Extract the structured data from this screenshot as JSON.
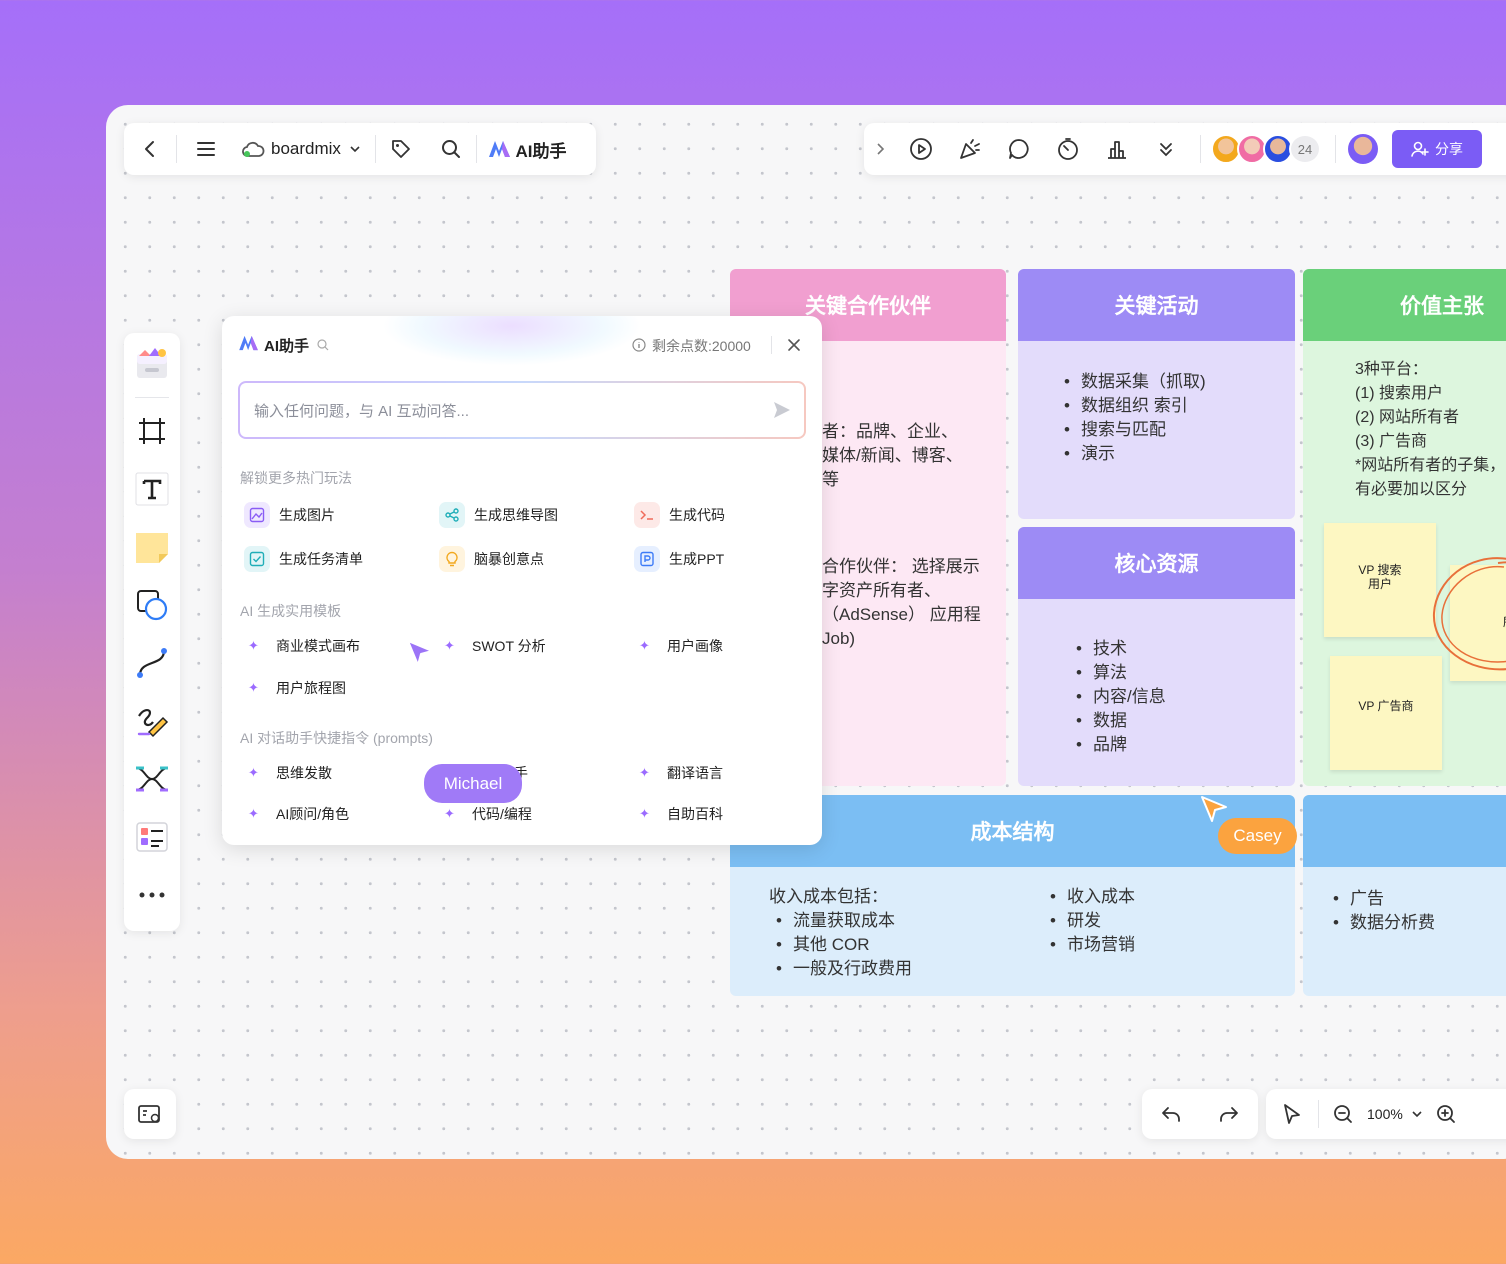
{
  "toolbar": {
    "board_name": "boardmix",
    "ai_label": "AI助手",
    "avatar_count": "24",
    "share_label": "分享"
  },
  "ai_panel": {
    "title": "AI助手",
    "points": "剩余点数:20000",
    "input_placeholder": "输入任何问题，与 AI 互动问答...",
    "section1": "解锁更多热门玩法",
    "features": [
      "生成图片",
      "生成思维导图",
      "生成代码",
      "生成任务清单",
      "脑暴创意点",
      "生成PPT"
    ],
    "section2": "AI 生成实用模板",
    "templates": [
      "商业模式画布",
      "SWOT 分析",
      "用户画像",
      "用户旅程图"
    ],
    "section3": "AI 对话助手快捷指令 (prompts)",
    "prompts": [
      "思维发散",
      "写作助手",
      "翻译语言",
      "AI顾问/角色",
      "代码/编程",
      "自助百科"
    ]
  },
  "canvas": {
    "partners": {
      "title": "关键合作伙伴",
      "text1": [
        "者：品牌、企业、",
        "媒体/新闻、博客、",
        "等"
      ],
      "text2": [
        "合作伙伴：  选择展示",
        "字资产所有者、",
        "（AdSense） 应用程",
        "Job)"
      ]
    },
    "activities": {
      "title": "关键活动",
      "items": [
        "数据采集（抓取)",
        "数据组织 索引",
        "搜索与匹配",
        "演示"
      ]
    },
    "resources": {
      "title": "核心资源",
      "items": [
        "技术",
        "算法",
        "内容/信息",
        "数据",
        "品牌"
      ]
    },
    "value": {
      "title": "价值主张",
      "lines": [
        "3种平台：",
        "(1) 搜索用户",
        "(2) 网站所有者",
        "(3) 广告商",
        "*网站所有者的子集，",
        "有必要加以区分"
      ],
      "sticky1": [
        "VP 搜索",
        "用户"
      ],
      "sticky2": [
        "VP 广告商"
      ],
      "sticky3": [
        "VP",
        "所有"
      ]
    },
    "cost": {
      "title": "成本结构",
      "intro": "收入成本包括：",
      "col1": [
        "流量获取成本",
        "其他 COR",
        "一般及行政费用"
      ],
      "col2": [
        "收入成本",
        "研发",
        "市场营销"
      ]
    },
    "revenue": {
      "items": [
        "广告",
        "数据分析费"
      ]
    }
  },
  "cursors": {
    "michael": "Michael",
    "casey": "Casey"
  },
  "zoom": {
    "level": "100%"
  },
  "colors": {
    "accent": "#7b5cf5",
    "partners_header": "#f19fd0",
    "partners_body": "#fde8f4",
    "activities_header": "#9d8bf5",
    "activities_body": "#e3dcfb",
    "value_header": "#6ad07a",
    "value_body": "#ddf6de",
    "cost_header": "#7bbef3",
    "cost_body": "#dcedfb",
    "michael_tag": "#a07af7",
    "casey_tag": "#fba33f"
  }
}
